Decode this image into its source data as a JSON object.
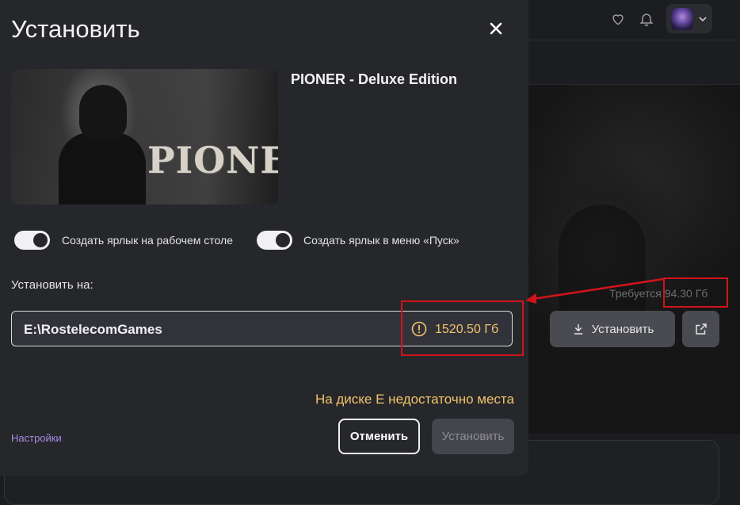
{
  "modal": {
    "title": "Установить",
    "game_title": "PIONER - Deluxe Edition",
    "cover_logo": "PIONER",
    "toggles": [
      {
        "label": "Создать ярлык на рабочем столе",
        "on": true
      },
      {
        "label": "Создать ярлык в меню «Пуск»",
        "on": true
      }
    ],
    "install_on_label": "Установить на:",
    "path_value": "E:\\RostelecomGames",
    "free_space": "1520.50 Гб",
    "warning_text": "На диске E недостаточно места",
    "settings_link": "Настройки",
    "cancel_label": "Отменить",
    "install_label": "Установить"
  },
  "background": {
    "required_text": "Требуется 94.30 Гб",
    "install_label": "Установить"
  },
  "colors": {
    "warning": "#f0c36b",
    "link": "#a98ae6",
    "annotation": "#d1141a"
  }
}
